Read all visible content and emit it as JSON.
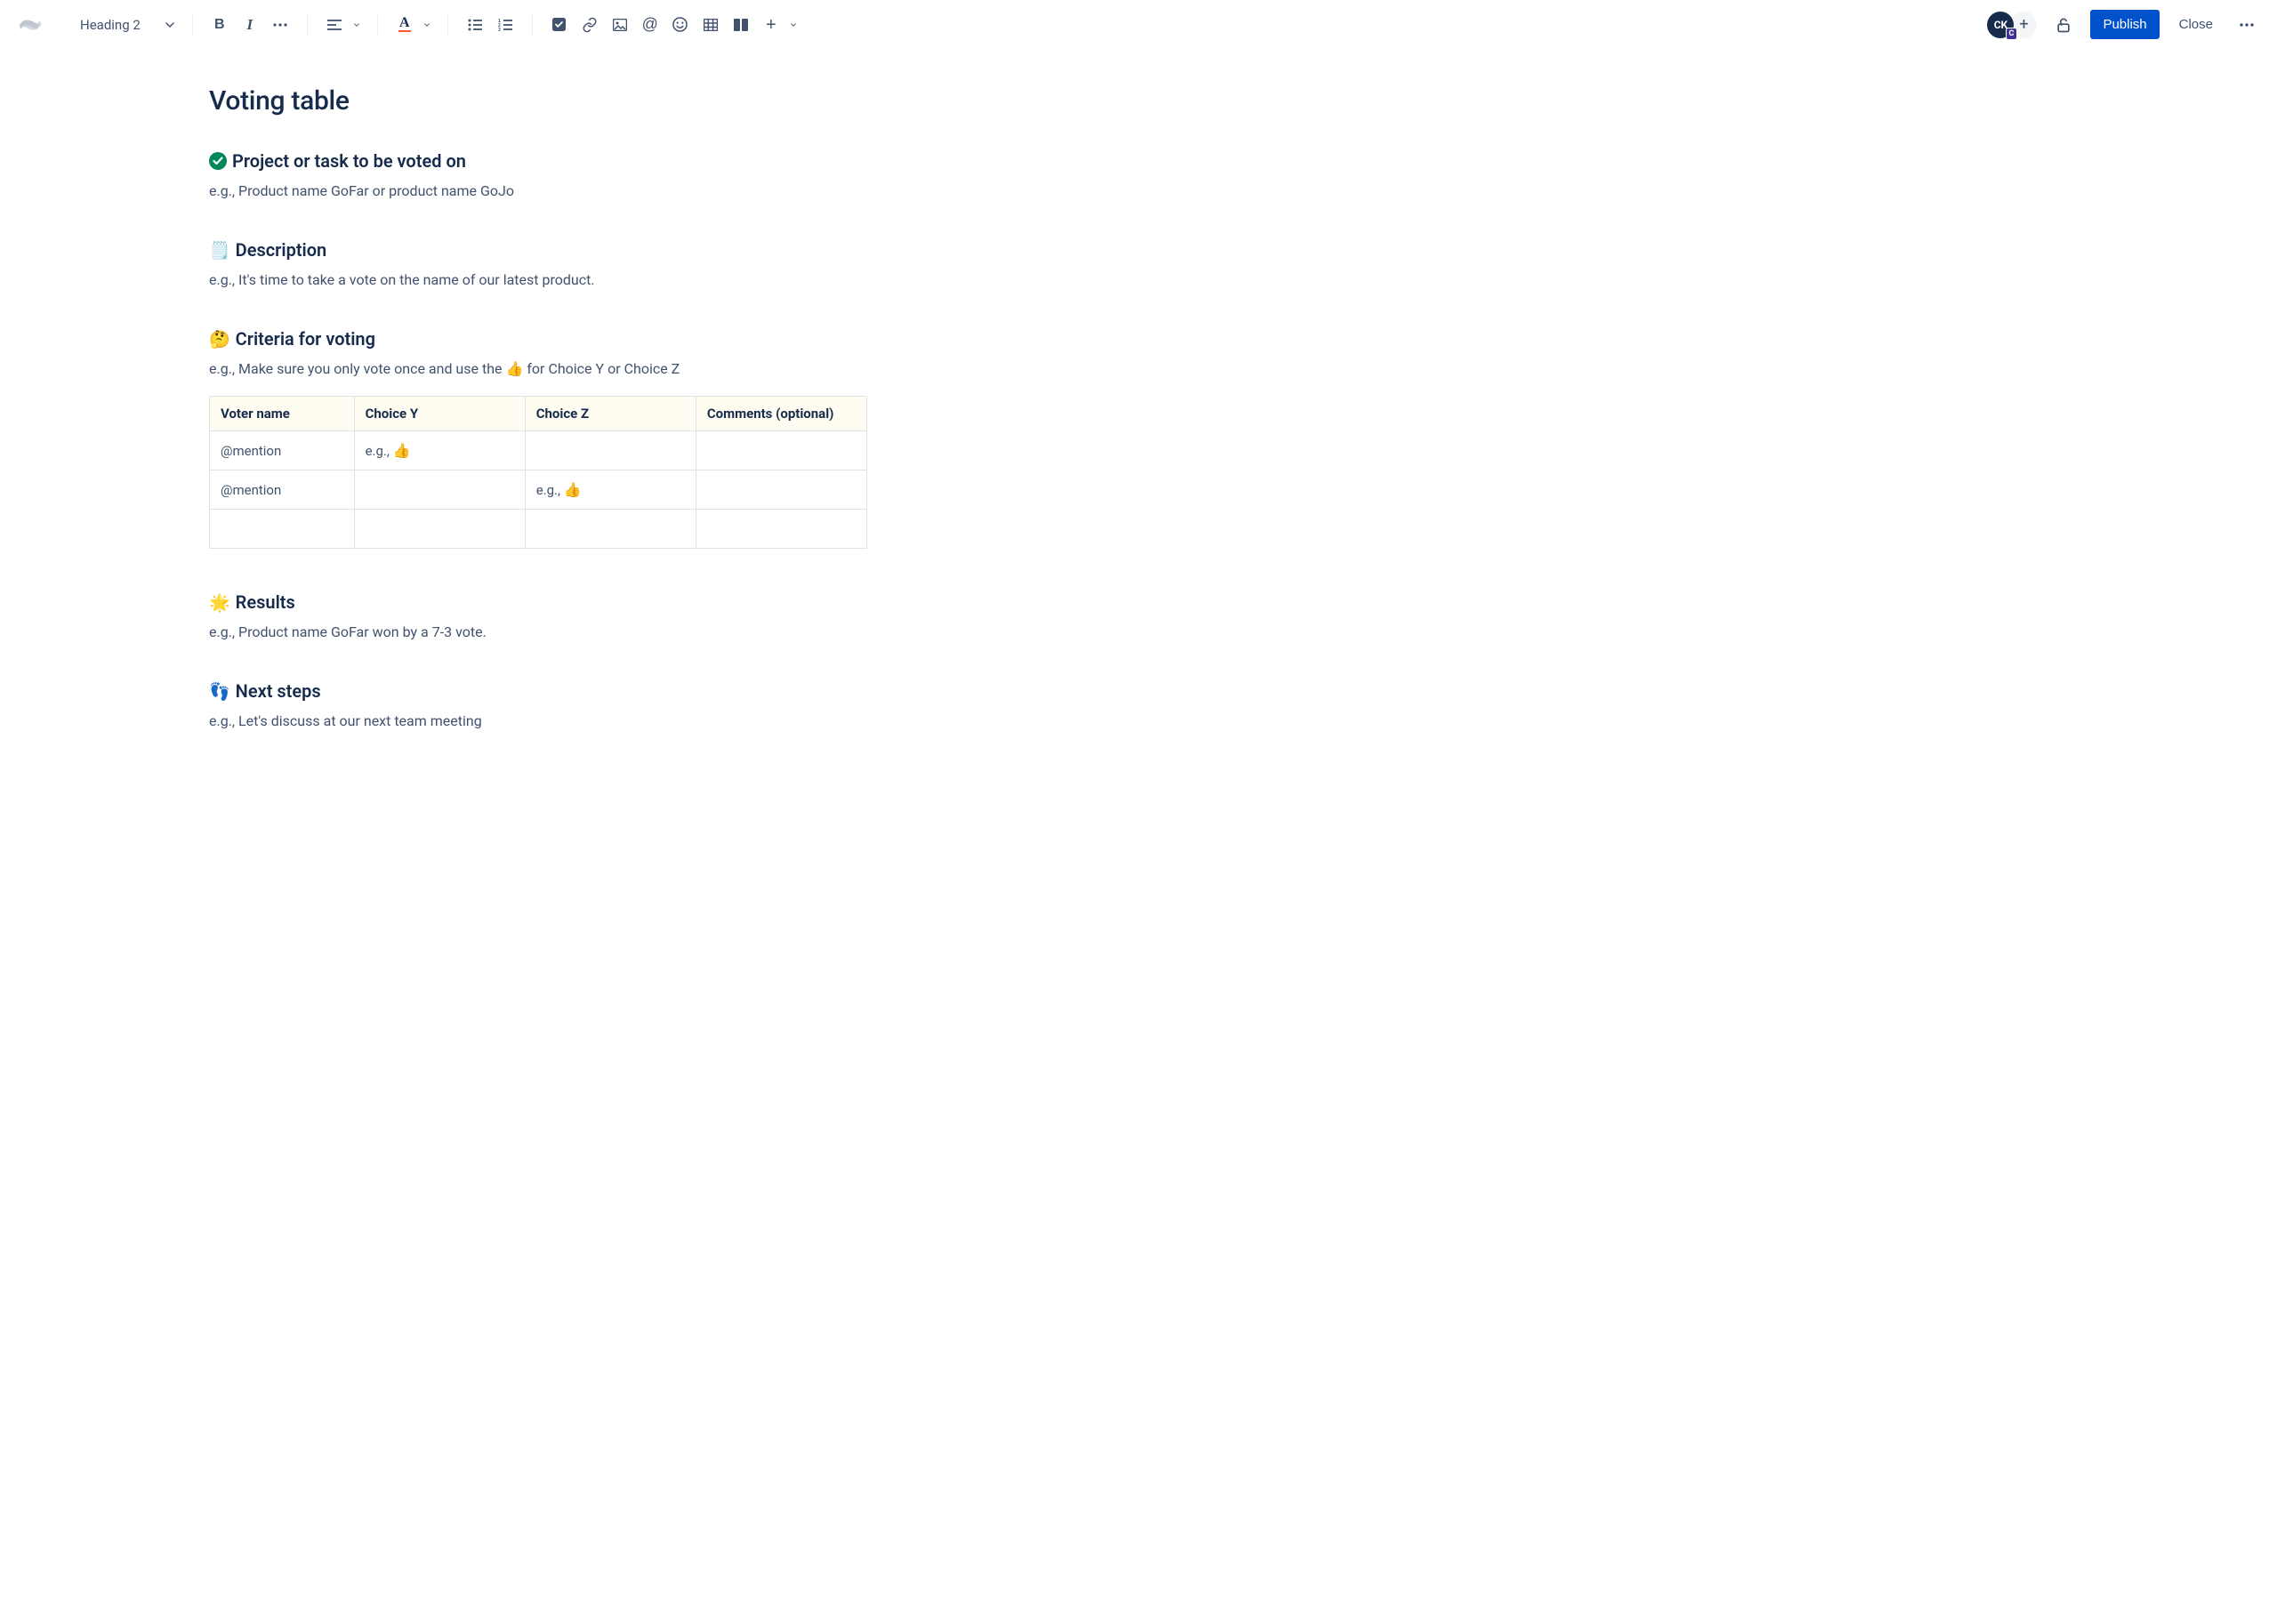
{
  "toolbar": {
    "heading_selector": "Heading 2",
    "publish_label": "Publish",
    "close_label": "Close",
    "avatar_initials": "CK",
    "avatar_badge": "C"
  },
  "page": {
    "title": "Voting table"
  },
  "sections": {
    "project": {
      "heading": "Project or task to be voted on",
      "body": "e.g., Product name GoFar or product name GoJo"
    },
    "description": {
      "heading": "Description",
      "body": "e.g., It's time to take a vote on the name of our latest product.",
      "emoji": "🗒️"
    },
    "criteria": {
      "heading": "Criteria for voting",
      "body_pre": "e.g., Make sure you only vote once and use the ",
      "body_post": " for Choice Y or Choice Z",
      "emoji": "🤔",
      "thumb": "👍"
    },
    "results": {
      "heading": "Results",
      "body": "e.g., Product name GoFar won by a 7-3 vote.",
      "emoji": "🌟"
    },
    "next": {
      "heading": "Next steps",
      "body": "e.g., Let's discuss at our next team meeting",
      "emoji": "👣"
    }
  },
  "table": {
    "headers": [
      "Voter name",
      "Choice Y",
      "Choice Z",
      "Comments (optional)"
    ],
    "rows": [
      {
        "name": "@mention",
        "y_pre": "e.g., ",
        "y_thumb": "👍",
        "z_pre": "",
        "z_thumb": "",
        "comment": ""
      },
      {
        "name": "@mention",
        "y_pre": "",
        "y_thumb": "",
        "z_pre": "e.g., ",
        "z_thumb": "👍",
        "comment": ""
      },
      {
        "name": "",
        "y_pre": "",
        "y_thumb": "",
        "z_pre": "",
        "z_thumb": "",
        "comment": ""
      }
    ]
  }
}
